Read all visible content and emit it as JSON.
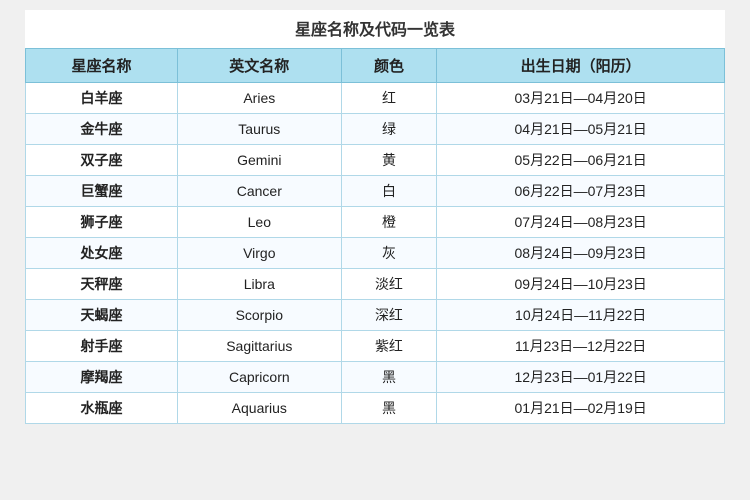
{
  "title": "星座名称及代码一览表",
  "headers": [
    "星座名称",
    "英文名称",
    "颜色",
    "出生日期（阳历）"
  ],
  "rows": [
    {
      "chinese": "白羊座",
      "english": "Aries",
      "color": "红",
      "date": "03月21日—04月20日"
    },
    {
      "chinese": "金牛座",
      "english": "Taurus",
      "color": "绿",
      "date": "04月21日—05月21日"
    },
    {
      "chinese": "双子座",
      "english": "Gemini",
      "color": "黄",
      "date": "05月22日—06月21日"
    },
    {
      "chinese": "巨蟹座",
      "english": "Cancer",
      "color": "白",
      "date": "06月22日—07月23日"
    },
    {
      "chinese": "狮子座",
      "english": "Leo",
      "color": "橙",
      "date": "07月24日—08月23日"
    },
    {
      "chinese": "处女座",
      "english": "Virgo",
      "color": "灰",
      "date": "08月24日—09月23日"
    },
    {
      "chinese": "天秤座",
      "english": "Libra",
      "color": "淡红",
      "date": "09月24日—10月23日"
    },
    {
      "chinese": "天蝎座",
      "english": "Scorpio",
      "color": "深红",
      "date": "10月24日—11月22日"
    },
    {
      "chinese": "射手座",
      "english": "Sagittarius",
      "color": "紫红",
      "date": "11月23日—12月22日"
    },
    {
      "chinese": "摩羯座",
      "english": "Capricorn",
      "color": "黑",
      "date": "12月23日—01月22日"
    },
    {
      "chinese": "水瓶座",
      "english": "Aquarius",
      "color": "黑",
      "date": "01月21日—02月19日"
    }
  ]
}
